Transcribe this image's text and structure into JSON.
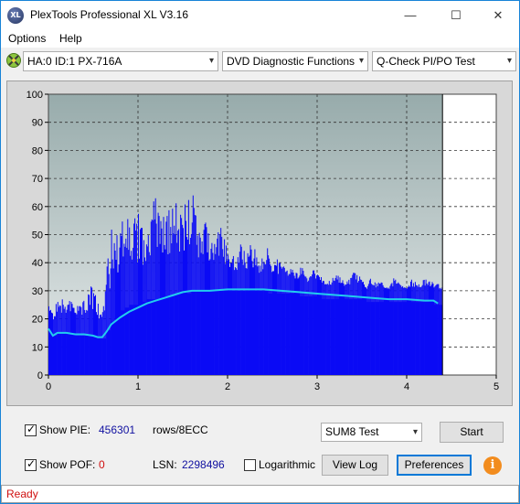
{
  "window": {
    "title": "PlexTools Professional XL V3.16",
    "icon_text": "XL",
    "minimize_symbol": "—",
    "maximize_symbol": "☐",
    "close_symbol": "✕"
  },
  "menu": {
    "options": "Options",
    "help": "Help"
  },
  "toolbar": {
    "drive": "HA:0 ID:1  PX-716A",
    "function": "DVD Diagnostic Functions",
    "test": "Q-Check PI/PO Test",
    "dropdown_symbol": "▾"
  },
  "chart_data": {
    "type": "area",
    "xlim": [
      0,
      5
    ],
    "ylim": [
      0,
      100
    ],
    "x_ticks": [
      "0",
      "1",
      "2",
      "3",
      "4",
      "5"
    ],
    "y_ticks": [
      "0",
      "10",
      "20",
      "30",
      "40",
      "50",
      "60",
      "70",
      "80",
      "90",
      "100"
    ],
    "scan_end_x": 4.4,
    "grid": true,
    "colors": {
      "plot_bg_top": "#97abab",
      "plot_bg_bottom": "#e8ecec",
      "bars": "#0a0af5",
      "line": "#22ccee",
      "empty": "#ffffff"
    },
    "series": [
      {
        "kind": "bars",
        "x": [
          0.0,
          0.05,
          0.1,
          0.15,
          0.2,
          0.25,
          0.3,
          0.35,
          0.4,
          0.45,
          0.5,
          0.55,
          0.6,
          0.65,
          0.7,
          0.75,
          0.8,
          0.85,
          0.9,
          0.95,
          1.0,
          1.05,
          1.1,
          1.15,
          1.2,
          1.25,
          1.3,
          1.35,
          1.4,
          1.45,
          1.5,
          1.55,
          1.6,
          1.65,
          1.7,
          1.75,
          1.8,
          1.85,
          1.9,
          1.95,
          2.0,
          2.05,
          2.1,
          2.15,
          2.2,
          2.25,
          2.3,
          2.35,
          2.4,
          2.45,
          2.5,
          2.55,
          2.6,
          2.65,
          2.7,
          2.75,
          2.8,
          2.85,
          2.9,
          2.95,
          3.0,
          3.05,
          3.1,
          3.15,
          3.2,
          3.25,
          3.3,
          3.35,
          3.4,
          3.45,
          3.5,
          3.55,
          3.6,
          3.65,
          3.7,
          3.75,
          3.8,
          3.85,
          3.9,
          3.95,
          4.0,
          4.05,
          4.1,
          4.15,
          4.2,
          4.25,
          4.3,
          4.35
        ],
        "values": [
          25,
          23,
          28,
          27,
          24,
          30,
          26,
          25,
          28,
          32,
          31,
          26,
          24,
          45,
          52,
          55,
          54,
          57,
          56,
          58,
          60,
          52,
          57,
          62,
          66,
          55,
          62,
          58,
          69,
          65,
          60,
          63,
          67,
          58,
          53,
          56,
          52,
          50,
          55,
          50,
          45,
          44,
          42,
          48,
          44,
          48,
          45,
          40,
          43,
          46,
          38,
          42,
          40,
          38,
          39,
          36,
          40,
          37,
          34,
          38,
          36,
          35,
          33,
          34,
          36,
          35,
          33,
          34,
          37,
          36,
          34,
          32,
          35,
          33,
          34,
          32,
          31,
          35,
          33,
          32,
          31,
          34,
          33,
          32,
          35,
          36,
          32,
          33
        ],
        "base": [
          17,
          14,
          15,
          15,
          15,
          15,
          14,
          14,
          14,
          14,
          14,
          13,
          13,
          16,
          19,
          22,
          23,
          24,
          25,
          25,
          26,
          26,
          27,
          27,
          27,
          28,
          28,
          28,
          29,
          29,
          29,
          29,
          30,
          30,
          30,
          30,
          30,
          30,
          30,
          30,
          30,
          30,
          30,
          30,
          30,
          30,
          30,
          30,
          30,
          29,
          29,
          29,
          29,
          29,
          29,
          28,
          28,
          28,
          28,
          28,
          28,
          27,
          27,
          27,
          27,
          27,
          27,
          27,
          27,
          27,
          26,
          26,
          26,
          26,
          26,
          26,
          26,
          26,
          26,
          26,
          26,
          26,
          26,
          26,
          26,
          25,
          25,
          25
        ]
      },
      {
        "kind": "line",
        "x": [
          0.0,
          0.05,
          0.1,
          0.2,
          0.3,
          0.4,
          0.5,
          0.55,
          0.6,
          0.65,
          0.7,
          0.8,
          0.9,
          1.0,
          1.1,
          1.2,
          1.3,
          1.4,
          1.5,
          1.6,
          1.7,
          1.8,
          2.0,
          2.2,
          2.4,
          2.6,
          2.8,
          3.0,
          3.2,
          3.4,
          3.6,
          3.8,
          4.0,
          4.2,
          4.3,
          4.35
        ],
        "values": [
          16.5,
          14,
          15,
          15,
          14.5,
          14.5,
          14,
          13.5,
          13.5,
          15.5,
          18,
          20.5,
          22.5,
          24,
          25.5,
          26.5,
          27.5,
          28.5,
          29.5,
          30,
          30,
          30,
          30.5,
          30.5,
          30.5,
          30,
          29.5,
          29,
          28.5,
          28,
          27.5,
          27,
          27,
          26.5,
          26.5,
          25.5
        ]
      }
    ]
  },
  "controls": {
    "show_pie_label": "Show PIE:",
    "pie_value": "456301",
    "rows_unit": "rows/8ECC",
    "show_pof_label": "Show POF:",
    "pof_value": "0",
    "lsn_label": "LSN:",
    "lsn_value": "2298496",
    "logarithmic_label": "Logarithmic",
    "test_select": "SUM8 Test",
    "start_label": "Start",
    "view_log_label": "View Log",
    "preferences_label": "Preferences",
    "info_symbol": "i",
    "check_symbol": "✓"
  },
  "status": {
    "text": "Ready"
  }
}
